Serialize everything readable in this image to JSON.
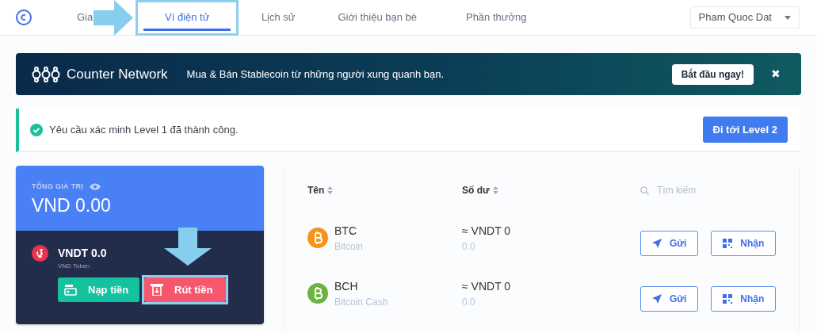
{
  "nav": {
    "tabs": [
      {
        "label": "Gia",
        "selected": false,
        "highlighted": false
      },
      {
        "label": "Ví điện tử",
        "selected": true,
        "highlighted": true
      },
      {
        "label": "Lịch sử",
        "selected": false,
        "highlighted": false
      },
      {
        "label": "Giới thiệu bạn bè",
        "selected": false,
        "highlighted": false
      },
      {
        "label": "Phần thưởng",
        "selected": false,
        "highlighted": false
      }
    ],
    "user": "Pham Quoc Dat"
  },
  "banner": {
    "brand": "Counter Network",
    "text": "Mua & Bán Stablecoin từ những người xung quanh bạn.",
    "button": "Bắt đầu ngay!",
    "close": "✖"
  },
  "alert": {
    "text": "Yêu cầu xác minh Level 1 đã thành công.",
    "button": "Đi tới Level 2"
  },
  "summary": {
    "label": "TỔNG GIÁ TRỊ",
    "total": "VND 0.00",
    "token": {
      "amount": "VNDT 0.0",
      "name": "VND Token"
    },
    "actions": [
      {
        "label": "Nạp tiền",
        "kind": "deposit",
        "highlighted": false
      },
      {
        "label": "Rút tiền",
        "kind": "withdraw",
        "highlighted": true
      }
    ]
  },
  "table": {
    "columns": [
      "Tên",
      "Số dư"
    ],
    "search": {
      "placeholder": "Tìm kiếm"
    },
    "rows": [
      {
        "symbol": "BTC",
        "name": "Bitcoin",
        "balance": "≈ VNDT 0",
        "amount": "0.0",
        "color": "#f7931a",
        "actions": [
          "Gửi",
          "Nhận"
        ]
      },
      {
        "symbol": "BCH",
        "name": "Bitcoin Cash",
        "balance": "≈ VNDT 0",
        "amount": "0.0",
        "color": "#6cb33f",
        "actions": [
          "Gửi",
          "Nhận"
        ]
      }
    ]
  }
}
